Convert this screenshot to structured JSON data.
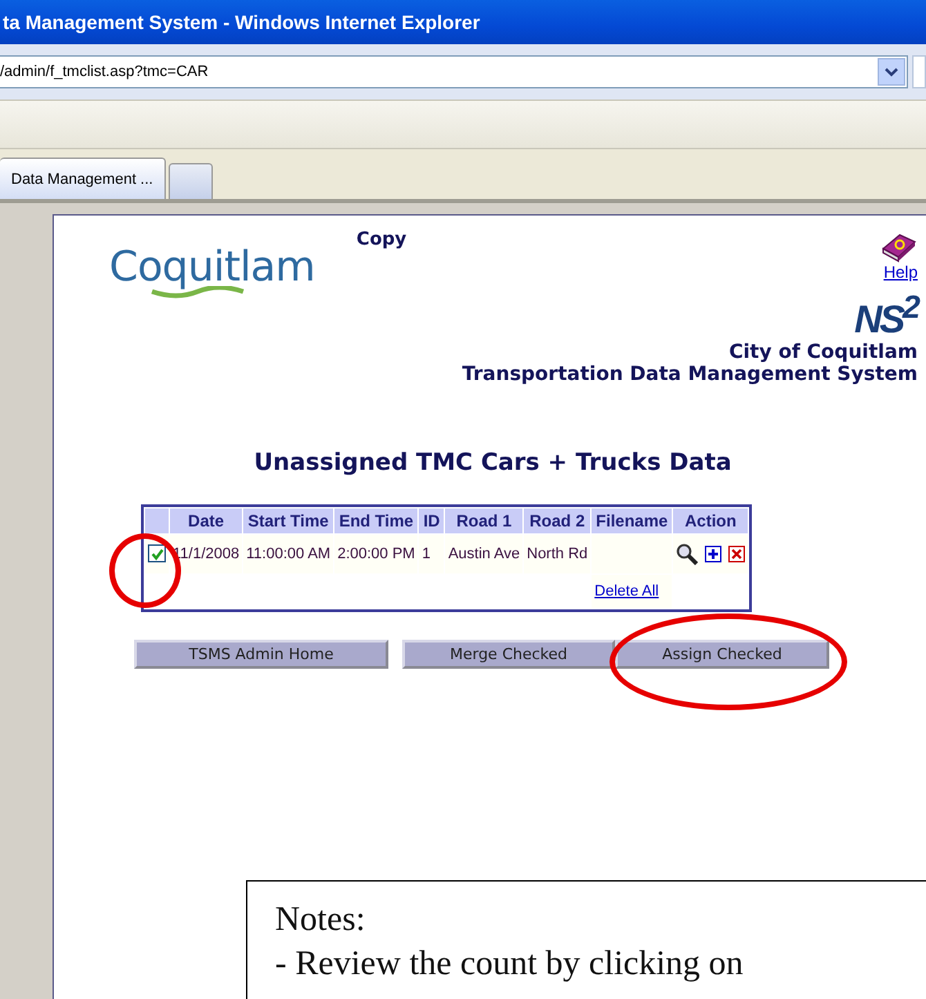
{
  "window": {
    "title": "ta Management System - Windows Internet Explorer"
  },
  "address_bar": {
    "value": "/admin/f_tmclist.asp?tmc=CAR"
  },
  "tabs": [
    {
      "label": "Data Management ...",
      "selected": true
    },
    {
      "selected": false
    }
  ],
  "page": {
    "copy_label": "Copy",
    "logo_text": "Coquitlam",
    "help_link": "Help",
    "badge_text": "NS$^{2}$",
    "org_name": "City of Coquitlam",
    "system_name": "Transportation Data Management System",
    "heading": "Unassigned TMC Cars + Trucks Data",
    "table": {
      "columns": [
        "Date",
        "Start Time",
        "End Time",
        "ID",
        "Road 1",
        "Road 2",
        "Filename",
        "Action"
      ],
      "rows": [
        {
          "checked": true,
          "cells": [
            "11/1/2008",
            "11:00:00 AM",
            "2:00:00 PM",
            "1",
            "Austin Ave",
            "North Rd",
            ""
          ]
        }
      ],
      "footer_link": "Delete All"
    },
    "buttons": [
      "TSMS Admin Home",
      "Merge Checked",
      "Assign Checked"
    ]
  },
  "annotations": [
    {
      "kind": "ellipse"
    },
    {
      "kind": "ellipse"
    }
  ],
  "notes": {
    "title": "Notes:",
    "line": "- Review the count by clicking on"
  }
}
